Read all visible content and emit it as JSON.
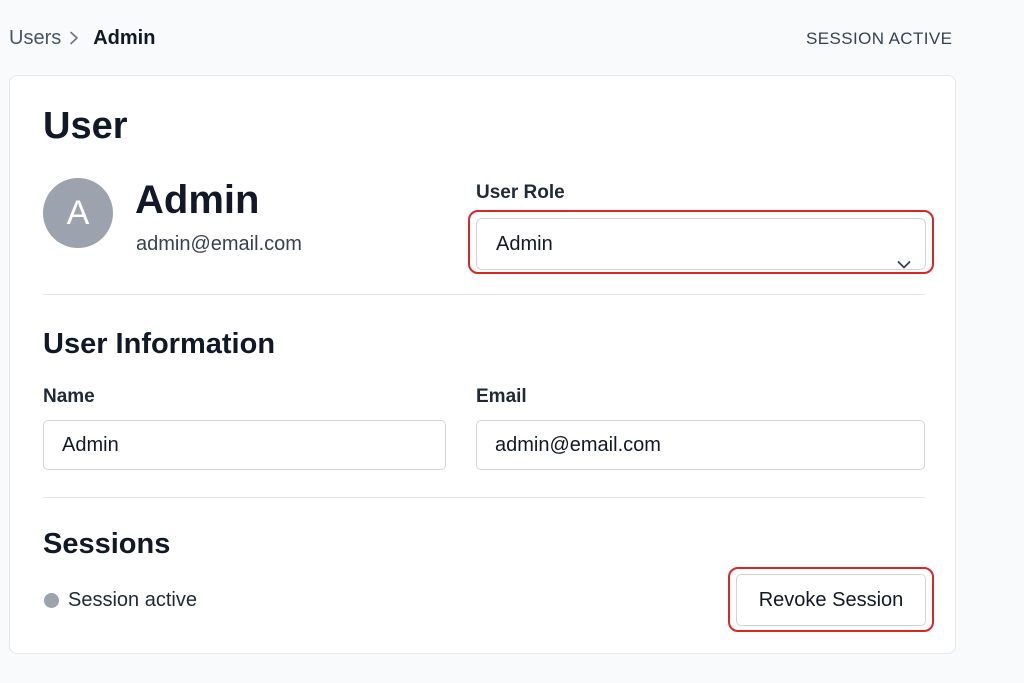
{
  "breadcrumb": {
    "parent": "Users",
    "current": "Admin"
  },
  "header": {
    "session_status": "SESSION ACTIVE"
  },
  "card": {
    "title": "User",
    "profile": {
      "initial": "A",
      "name": "Admin",
      "email": "admin@email.com"
    },
    "role": {
      "label": "User Role",
      "selected": "Admin"
    },
    "user_info": {
      "title": "User Information",
      "name_label": "Name",
      "name_value": "Admin",
      "email_label": "Email",
      "email_value": "admin@email.com"
    },
    "sessions": {
      "title": "Sessions",
      "status_text": "Session active",
      "revoke_label": "Revoke Session"
    }
  },
  "icons": {
    "breadcrumb_separator": "chevron-right-icon",
    "select_chevron": "chevron-down-icon",
    "session_indicator": "status-dot-icon"
  },
  "colors": {
    "highlight": "#dc2626",
    "avatar": "#9ca3af",
    "status_dot": "#9ca3af"
  }
}
